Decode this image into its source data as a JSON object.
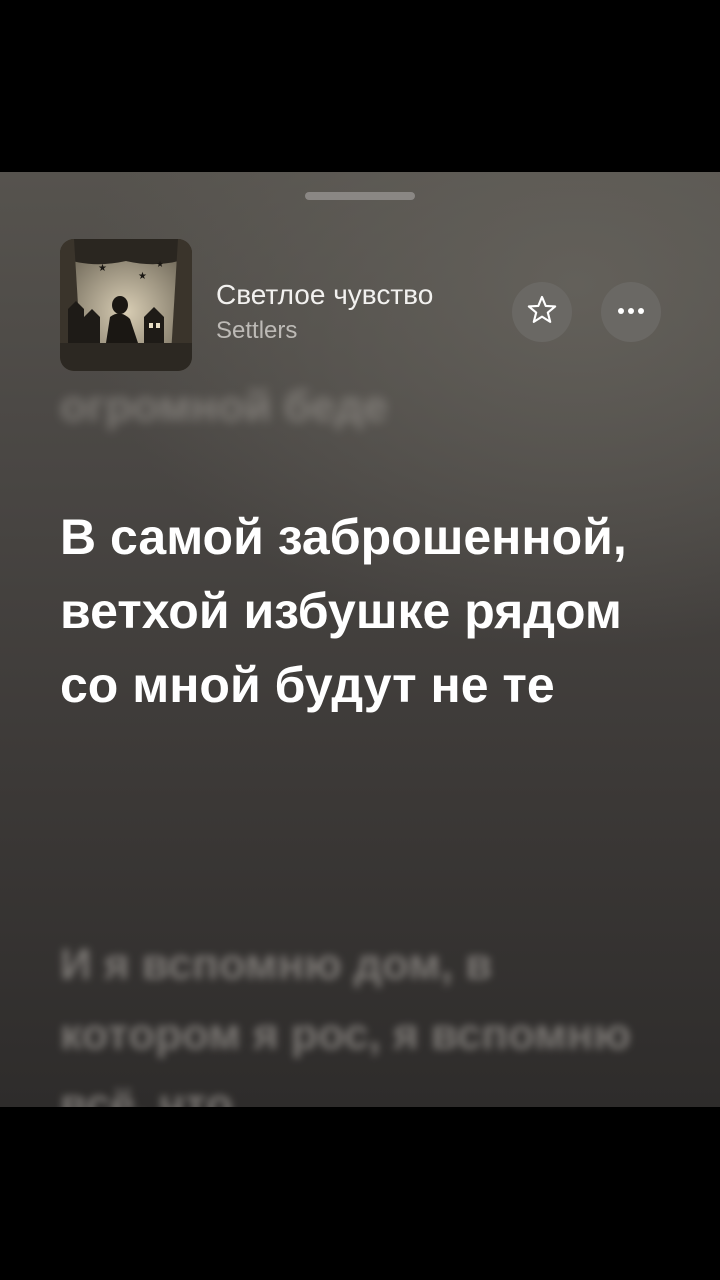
{
  "track": {
    "title": "Светлое чувство",
    "artist": "Settlers"
  },
  "icons": {
    "favorite": "star-outline-icon",
    "more": "ellipsis-icon"
  },
  "lyrics": {
    "previous": "огромной беде",
    "current": "В самой заброшенной, ветхой избушке рядом со мной будут не те",
    "next": "И я вспомню дом, в котором я рос, я вспомню всё, что"
  },
  "colors": {
    "current_line": "#ffffff",
    "button_bg": "#6a6864"
  }
}
